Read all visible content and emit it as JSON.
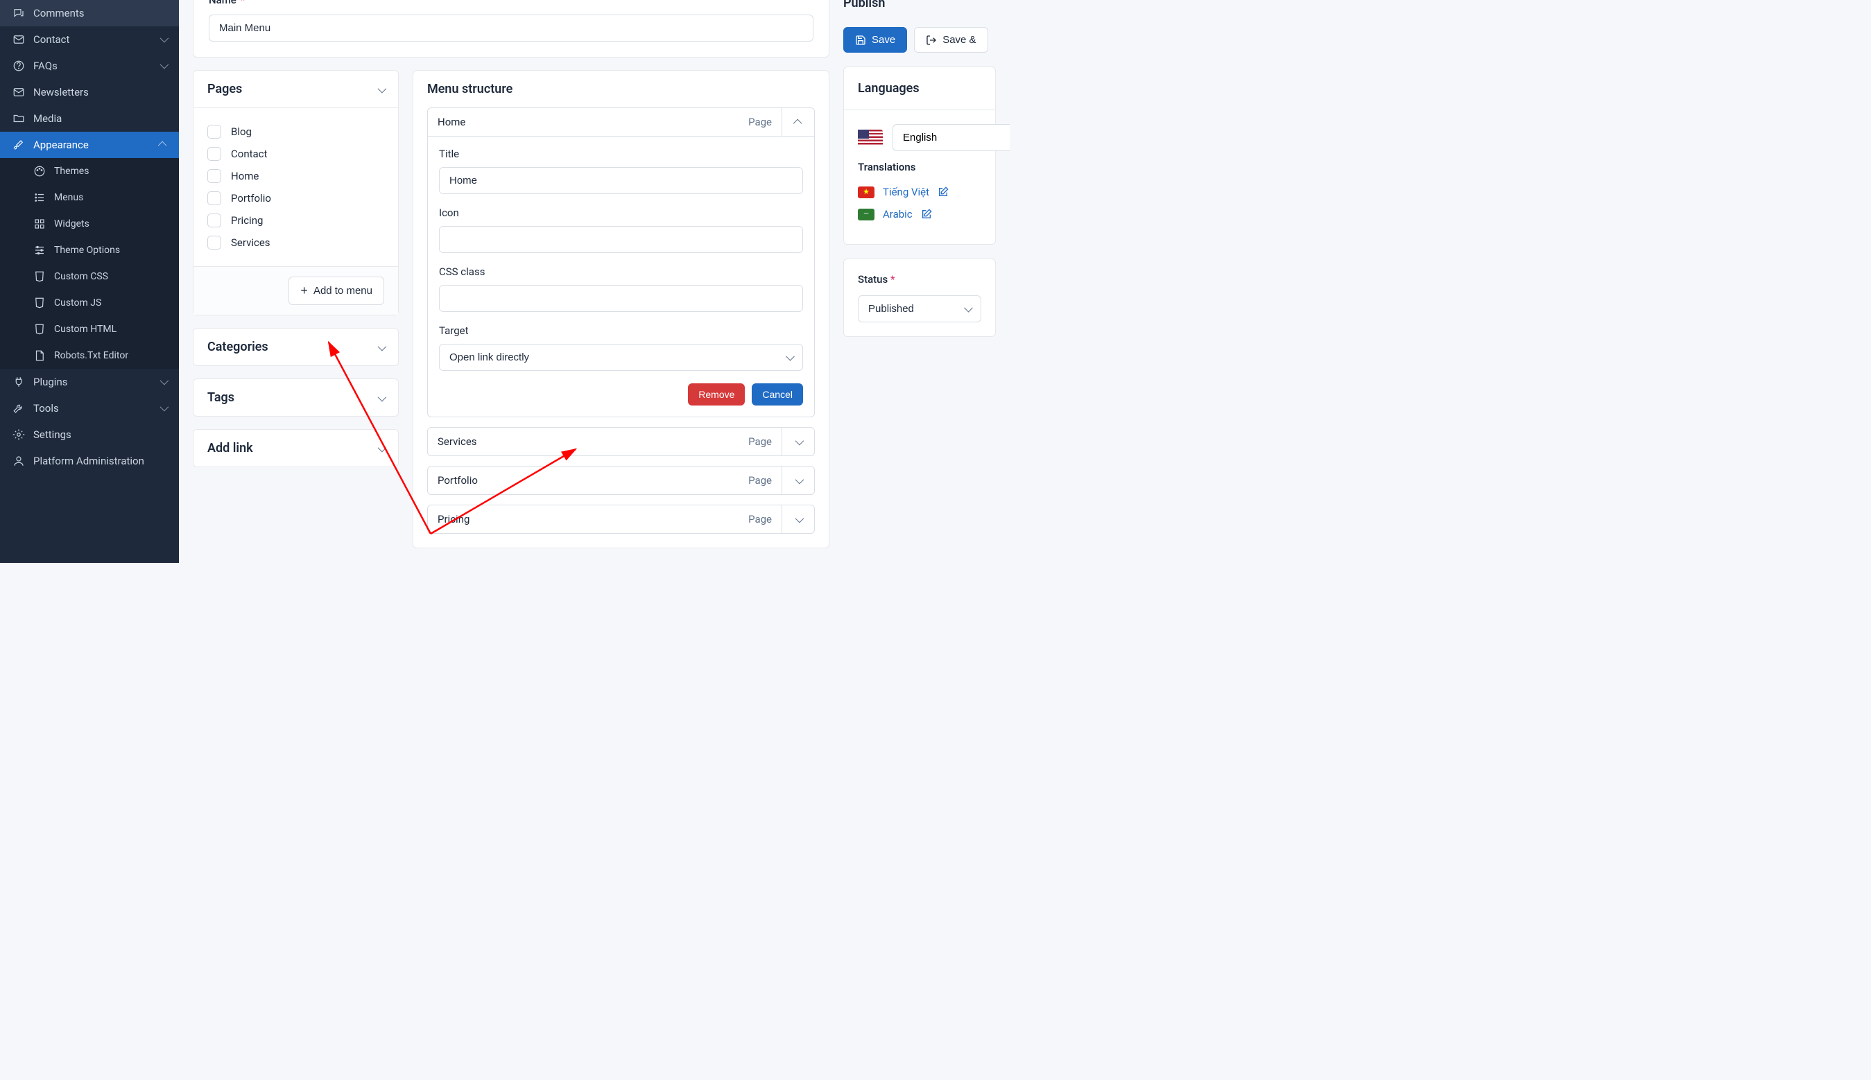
{
  "sidebar": {
    "items": [
      {
        "label": "Comments",
        "icon": "comments-icon"
      },
      {
        "label": "Contact",
        "icon": "mail-icon",
        "expandable": true
      },
      {
        "label": "FAQs",
        "icon": "help-icon",
        "expandable": true
      },
      {
        "label": "Newsletters",
        "icon": "mail-icon"
      },
      {
        "label": "Media",
        "icon": "folder-icon"
      },
      {
        "label": "Appearance",
        "icon": "brush-icon",
        "expandable": true,
        "active": true
      },
      {
        "label": "Plugins",
        "icon": "plug-icon",
        "expandable": true
      },
      {
        "label": "Tools",
        "icon": "tool-icon",
        "expandable": true
      },
      {
        "label": "Settings",
        "icon": "gear-icon"
      },
      {
        "label": "Platform Administration",
        "icon": "user-icon"
      }
    ],
    "appearance_sub": [
      {
        "label": "Themes",
        "icon": "palette-icon"
      },
      {
        "label": "Menus",
        "icon": "menus-icon"
      },
      {
        "label": "Widgets",
        "icon": "widgets-icon"
      },
      {
        "label": "Theme Options",
        "icon": "options-icon"
      },
      {
        "label": "Custom CSS",
        "icon": "css-icon"
      },
      {
        "label": "Custom JS",
        "icon": "js-icon"
      },
      {
        "label": "Custom HTML",
        "icon": "html-icon"
      },
      {
        "label": "Robots.Txt Editor",
        "icon": "txt-icon"
      }
    ]
  },
  "name_label": "Name",
  "name_value": "Main Menu",
  "pages": {
    "title": "Pages",
    "items": [
      "Blog",
      "Contact",
      "Home",
      "Portfolio",
      "Pricing",
      "Services"
    ],
    "add_btn": "Add to menu"
  },
  "categories_title": "Categories",
  "tags_title": "Tags",
  "addlink_title": "Add link",
  "structure": {
    "title": "Menu structure",
    "items": [
      {
        "label": "Home",
        "type": "Page",
        "expanded": true
      },
      {
        "label": "Services",
        "type": "Page"
      },
      {
        "label": "Portfolio",
        "type": "Page"
      },
      {
        "label": "Pricing",
        "type": "Page"
      }
    ],
    "detail": {
      "title_label": "Title",
      "title_value": "Home",
      "icon_label": "Icon",
      "icon_value": "",
      "css_label": "CSS class",
      "css_value": "",
      "target_label": "Target",
      "target_value": "Open link directly",
      "remove_btn": "Remove",
      "cancel_btn": "Cancel"
    }
  },
  "publish": {
    "title": "Publish",
    "save_btn": "Save",
    "save_exit_btn": "Save & "
  },
  "languages": {
    "title": "Languages",
    "current": "English",
    "translations_label": "Translations",
    "items": [
      {
        "label": "Tiếng Việt",
        "flag": "vn"
      },
      {
        "label": "Arabic",
        "flag": "ar"
      }
    ]
  },
  "status": {
    "label": "Status",
    "value": "Published"
  }
}
